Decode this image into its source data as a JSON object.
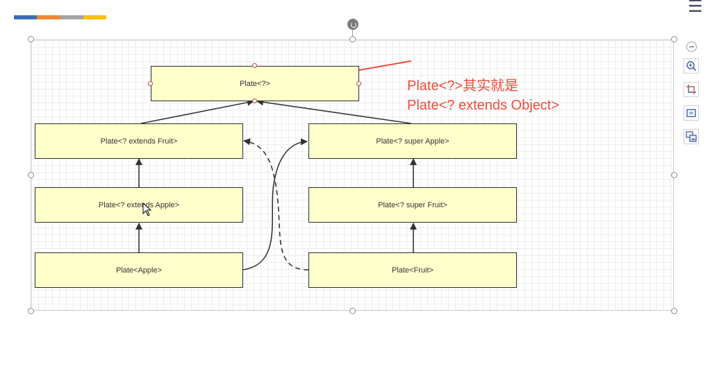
{
  "brand_strip_colors": [
    "#3d6db5",
    "#ef8733",
    "#a5a5a5",
    "#f9c000"
  ],
  "diagram": {
    "nodes": {
      "root": "Plate<?>",
      "extends_fruit": "Plate<? extends Fruit>",
      "super_apple": "Plate<? super Apple>",
      "extends_apple": "Plate<? extends Apple>",
      "super_fruit": "Plate<? super Fruit>",
      "apple": "Plate<Apple>",
      "fruit": "Plate<Fruit>"
    },
    "node_fill": "#ffffcc",
    "annotation": {
      "line1": "Plate<?>其实就是",
      "line2": "Plate<? extends Object>",
      "color": "#f0493a"
    }
  },
  "toolbar": {
    "tools": [
      "minus-icon",
      "zoom-in-icon",
      "crop-icon",
      "fit-frame-icon",
      "replace-image-icon"
    ]
  }
}
